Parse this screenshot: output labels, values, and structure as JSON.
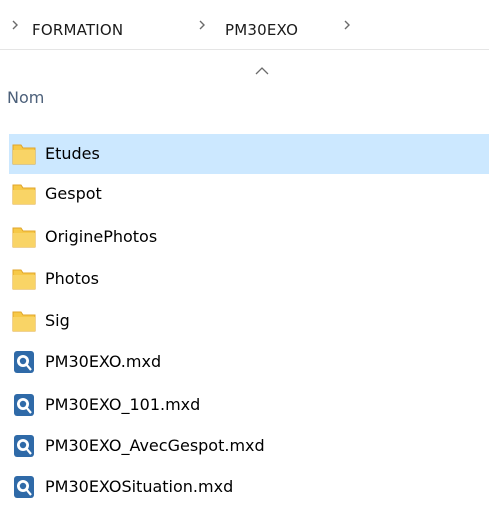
{
  "breadcrumb": {
    "items": [
      "FORMATION",
      "PM30EXO"
    ]
  },
  "header": {
    "column": "Nom",
    "sort": "ascending"
  },
  "colors": {
    "folder": "#f7c948",
    "folder_dark": "#e0a52a",
    "selection": "#cce8ff",
    "header_text": "#4c607a",
    "mxd_icon": "#2f6aa8"
  },
  "files": [
    {
      "name": "Etudes",
      "type": "folder",
      "icon": "folder-icon",
      "selected": true
    },
    {
      "name": "Gespot",
      "type": "folder",
      "icon": "folder-icon",
      "selected": false
    },
    {
      "name": "OriginePhotos",
      "type": "folder",
      "icon": "folder-icon",
      "selected": false
    },
    {
      "name": "Photos",
      "type": "folder",
      "icon": "folder-icon",
      "selected": false
    },
    {
      "name": "Sig",
      "type": "folder",
      "icon": "folder-icon",
      "selected": false
    },
    {
      "name": "PM30EXO.mxd",
      "type": "mxd",
      "icon": "arcmap-document-icon",
      "selected": false
    },
    {
      "name": "PM30EXO_101.mxd",
      "type": "mxd",
      "icon": "arcmap-document-icon",
      "selected": false
    },
    {
      "name": "PM30EXO_AvecGespot.mxd",
      "type": "mxd",
      "icon": "arcmap-document-icon",
      "selected": false
    },
    {
      "name": "PM30EXOSituation.mxd",
      "type": "mxd",
      "icon": "arcmap-document-icon",
      "selected": false
    }
  ]
}
